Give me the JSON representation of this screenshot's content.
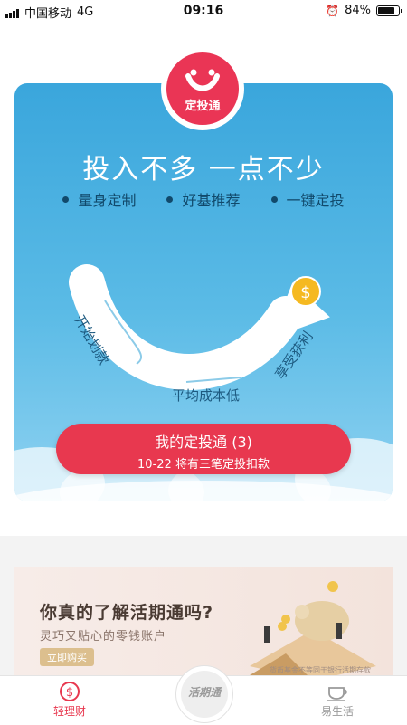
{
  "status_bar": {
    "carrier": "中国移动",
    "network": "4G",
    "time": "09:16",
    "battery": "84%",
    "battery_level": 0.84
  },
  "hero": {
    "badge_label": "定投通",
    "slogan": "投入不多 一点不少",
    "features": [
      "量身定制",
      "好基推荐",
      "一键定投"
    ],
    "curve_labels": {
      "start": "开始划款",
      "middle": "平均成本低",
      "end": "享受获利"
    },
    "coin_symbol": "$",
    "cta": {
      "title": "我的定投通 (3)",
      "subtitle": "10-22 将有三笔定投扣款"
    }
  },
  "promo": {
    "title": "你真的了解活期通吗?",
    "subtitle": "灵巧又贴心的零钱账户",
    "button": "立即购买",
    "disclaimer": "货币基金不等同于银行活期存款"
  },
  "tab_bar": {
    "left_label": "轻理财",
    "center_label": "活期通",
    "right_label": "易生活"
  },
  "colors": {
    "accent": "#e8384f",
    "card_blue": "#3aa6dc",
    "tab_active": "#e8384f",
    "tab_inactive": "#9a9a9a"
  }
}
